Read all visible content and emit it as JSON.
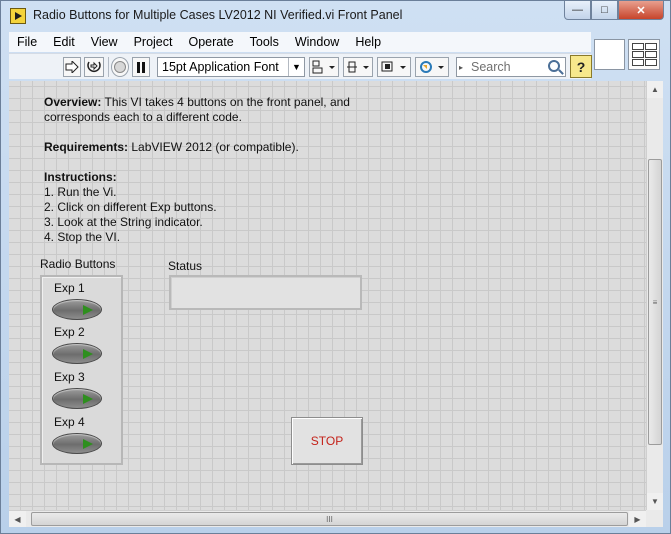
{
  "window": {
    "title": "Radio Buttons for Multiple Cases LV2012 NI Verified.vi Front Panel",
    "minimize": "—",
    "maximize": "□",
    "close": "✕"
  },
  "menu": [
    "File",
    "Edit",
    "View",
    "Project",
    "Operate",
    "Tools",
    "Window",
    "Help"
  ],
  "toolbar": {
    "font": "15pt Application Font",
    "search_placeholder": "Search",
    "help": "?"
  },
  "doc": {
    "overview_label": "Overview:",
    "overview_text": " This VI takes 4 buttons on the front panel, and corresponds each to a different code.",
    "requirements_label": "Requirements:",
    "requirements_text": " LabVIEW 2012 (or compatible).",
    "instructions_label": "Instructions:",
    "steps": [
      "1. Run the Vi.",
      "2. Click on different Exp buttons.",
      "3. Look at the String indicator.",
      "4. Stop the VI."
    ]
  },
  "radio_buttons": {
    "label": "Radio Buttons",
    "items": [
      "Exp 1",
      "Exp 2",
      "Exp 3",
      "Exp 4"
    ]
  },
  "status": {
    "label": "Status",
    "value": ""
  },
  "stop_label": "STOP",
  "scroll": {
    "grip": "≡",
    "hgrip": "III"
  },
  "colors": {
    "stop_text": "#c4221a",
    "led_on": "#2e8f1e",
    "panel_bg": "#dcdcdc"
  }
}
